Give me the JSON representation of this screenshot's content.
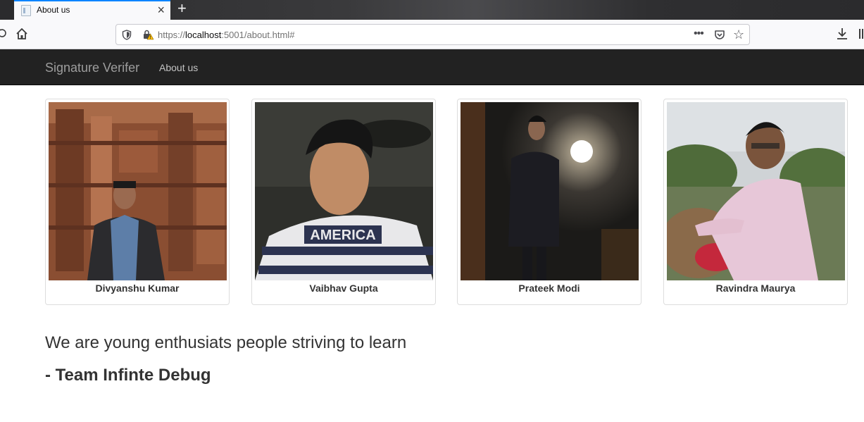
{
  "browser": {
    "tab_title": "About us",
    "new_tab_symbol": "+",
    "close_symbol": "×",
    "url_scheme": "https://",
    "url_host": "localhost",
    "url_rest": ":5001/about.html#",
    "more_symbol": "•••",
    "star_symbol": "☆",
    "icons": [
      "reload-icon",
      "home-icon",
      "shield-icon",
      "lock-warning-icon",
      "pocket-icon",
      "bookmark-star-icon",
      "download-icon",
      "library-icon"
    ]
  },
  "navbar": {
    "brand": "Signature Verifer",
    "link_about": "About us"
  },
  "team": [
    {
      "name": "Divyanshu Kumar"
    },
    {
      "name": "Vaibhav Gupta"
    },
    {
      "name": "Prateek Modi"
    },
    {
      "name": "Ravindra Maurya"
    }
  ],
  "content": {
    "tagline": "We are young enthusiats people striving to learn",
    "signature": "- Team Infinte Debug"
  },
  "colors": {
    "navbar_bg": "#222222",
    "brand_text": "#9d9d9d",
    "body_text": "#333333",
    "accent_tab": "#0a84ff"
  }
}
